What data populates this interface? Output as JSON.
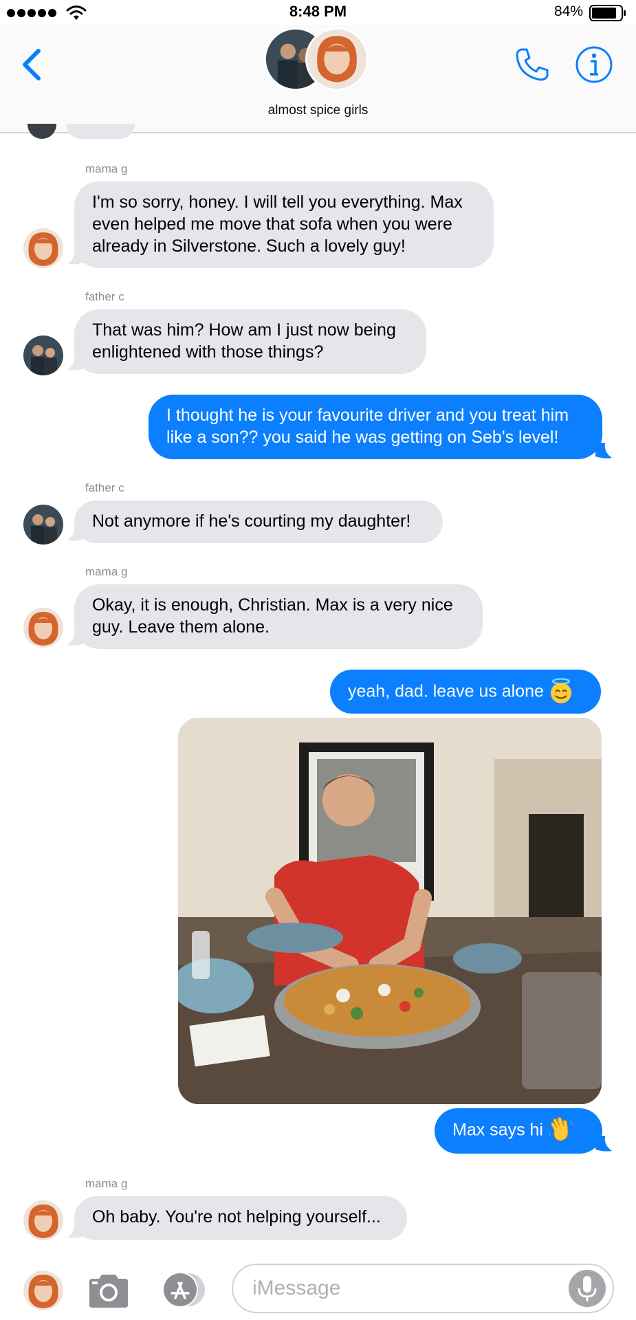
{
  "status_bar": {
    "time": "8:48 PM",
    "battery_percent": "84%",
    "battery_level": 0.84,
    "signal_icon": "signal-dots-icon",
    "wifi_icon": "wifi-icon"
  },
  "header": {
    "group_name": "almost spice girls",
    "back_icon": "chevron-left-icon",
    "call_icon": "phone-icon",
    "info_icon": "info-icon"
  },
  "colors": {
    "accent": "#0b7ffe",
    "incoming_bubble": "#e5e5ea",
    "sender_label": "#8e8e93"
  },
  "messages": [
    {
      "direction": "in",
      "sender": "mama g",
      "text": "I'm so sorry, honey. I will tell you everything. Max\neven helped me move that sofa when you were\nalready in Silverstone. Such a lovely guy!"
    },
    {
      "direction": "in",
      "sender": "father c",
      "text": "That was him? How am I just now being\nenlightened with those things?"
    },
    {
      "direction": "out",
      "text": "I thought he is your favourite driver and you treat him\nlike a son?? you said he was getting on Seb's level!"
    },
    {
      "direction": "in",
      "sender": "father c",
      "text": "Not anymore if he's courting my daughter!"
    },
    {
      "direction": "in",
      "sender": "mama g",
      "text": "Okay, it is enough, Christian. Max is a very nice\nguy. Leave them alone."
    },
    {
      "direction": "out",
      "text": "yeah, dad. leave us alone",
      "emoji": "smiling-face-with-halo-icon"
    },
    {
      "direction": "out",
      "type": "photo",
      "photo_icon": "photo-attachment"
    },
    {
      "direction": "out",
      "text": "Max says hi",
      "emoji": "waving-hand-icon"
    },
    {
      "direction": "in",
      "sender": "mama g",
      "text": "Oh baby. You're not helping yourself..."
    }
  ],
  "input_bar": {
    "placeholder": "iMessage",
    "camera_icon": "camera-icon",
    "apps_icon": "app-store-icon",
    "mic_icon": "microphone-icon"
  }
}
